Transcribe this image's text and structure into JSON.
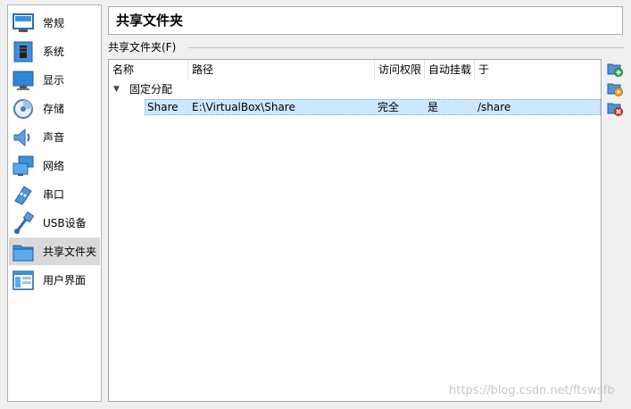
{
  "sidebar": {
    "items": [
      {
        "label": "常规",
        "icon": "general-icon"
      },
      {
        "label": "系统",
        "icon": "system-icon"
      },
      {
        "label": "显示",
        "icon": "display-icon"
      },
      {
        "label": "存储",
        "icon": "storage-icon"
      },
      {
        "label": "声音",
        "icon": "sound-icon"
      },
      {
        "label": "网络",
        "icon": "network-icon"
      },
      {
        "label": "串口",
        "icon": "serial-port-icon"
      },
      {
        "label": "USB设备",
        "icon": "usb-icon"
      },
      {
        "label": "共享文件夹",
        "icon": "shared-folder-icon",
        "selected": true
      },
      {
        "label": "用户界面",
        "icon": "user-interface-icon"
      }
    ]
  },
  "page": {
    "title": "共享文件夹"
  },
  "group": {
    "label": "共享文件夹(F)"
  },
  "table": {
    "columns": [
      "名称",
      "路径",
      "访问权限",
      "自动挂载",
      "于"
    ],
    "group_row": "固定分配",
    "rows": [
      {
        "name": "Share",
        "path": "E:\\VirtualBox\\Share",
        "access": "完全",
        "automount": "是",
        "at": "/share"
      }
    ]
  },
  "toolbar": {
    "add": "add-shared-folder-icon",
    "edit": "edit-shared-folder-icon",
    "remove": "remove-shared-folder-icon"
  },
  "watermark": "https://blog.csdn.net/ftswsfb",
  "colors": {
    "selection": "#cce8ff",
    "selected_nav": "#d9d9d9"
  }
}
